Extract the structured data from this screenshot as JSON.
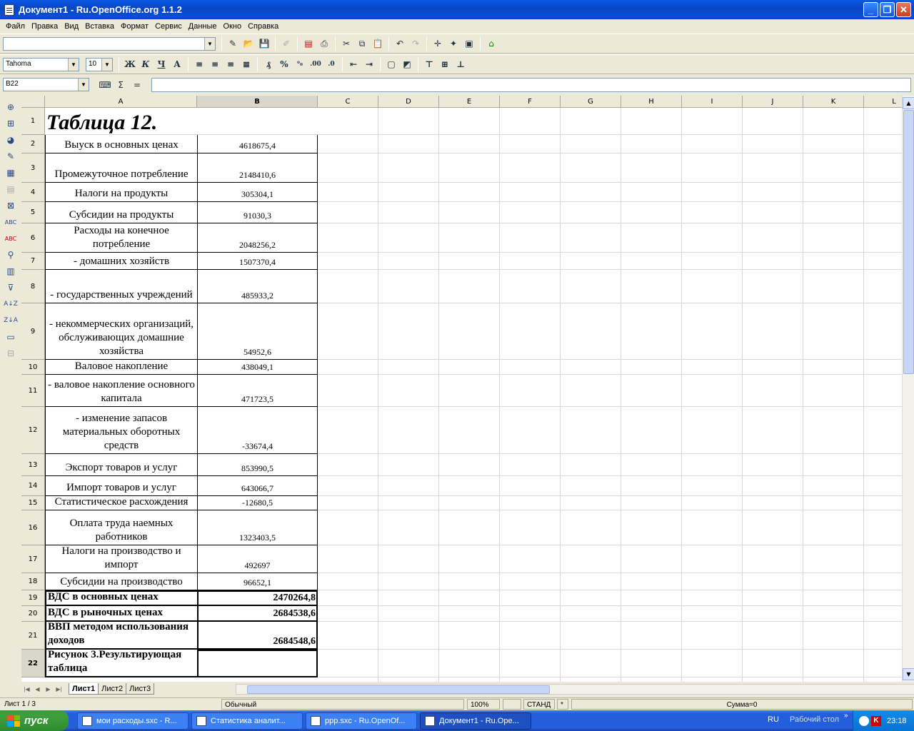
{
  "window": {
    "title": "Документ1 - Ru.OpenOffice.org 1.1.2",
    "minimize": "_",
    "maximize": "❐",
    "close": "✕"
  },
  "menu": [
    "Файл",
    "Правка",
    "Вид",
    "Вставка",
    "Формат",
    "Сервис",
    "Данные",
    "Окно",
    "Справка"
  ],
  "toolbar": {
    "font_name": "Tahoma",
    "font_size": "10",
    "bold": "Ж",
    "italic": "К",
    "underline": "Ч"
  },
  "formula_bar": {
    "cell_ref": "B22",
    "sum_symbol": "Σ",
    "equals": "=",
    "content": ""
  },
  "columns": [
    "A",
    "B",
    "C",
    "D",
    "E",
    "F",
    "G",
    "H",
    "I",
    "J",
    "K",
    "L"
  ],
  "selected_column": "B",
  "selected_row": "22",
  "title_cell": "Таблица 12.",
  "rows": [
    {
      "num": "1",
      "a": "",
      "b": ""
    },
    {
      "num": "2",
      "a": "Выуск в основных ценах",
      "b": "4618675,4"
    },
    {
      "num": "3",
      "a": "Промежуточное потребление",
      "b": "2148410,6"
    },
    {
      "num": "4",
      "a": "Налоги на продукты",
      "b": "305304,1"
    },
    {
      "num": "5",
      "a": "Субсидии на продукты",
      "b": "91030,3"
    },
    {
      "num": "6",
      "a": "Расходы на конечное потребление",
      "b": "2048256,2"
    },
    {
      "num": "7",
      "a": "- домашних хозяйств",
      "b": "1507370,4"
    },
    {
      "num": "8",
      "a": "- государственных учреждений",
      "b": "485933,2"
    },
    {
      "num": "9",
      "a": "- некоммерческих организаций, обслуживающих домашние хозяйства",
      "b": "54952,6"
    },
    {
      "num": "10",
      "a": "Валовое накопление",
      "b": "438049,1"
    },
    {
      "num": "11",
      "a": "- валовое накопление основного капитала",
      "b": "471723,5"
    },
    {
      "num": "12",
      "a": "- изменение запасов материальных оборотных средств",
      "b": "-33674,4"
    },
    {
      "num": "13",
      "a": "Экспорт товаров и услуг",
      "b": "853990,5"
    },
    {
      "num": "14",
      "a": "Импорт товаров и услуг",
      "b": "643066,7"
    },
    {
      "num": "15",
      "a": "Статистическое расхождения",
      "b": "-12680,5"
    },
    {
      "num": "16",
      "a": "Оплата труда наемных работников",
      "b": "1323403,5"
    },
    {
      "num": "17",
      "a": "Налоги на производство и импорт",
      "b": "492697"
    },
    {
      "num": "18",
      "a": "Субсидии на производство",
      "b": "96652,1"
    },
    {
      "num": "19",
      "a": "ВДС в основных ценах",
      "b": "2470264,8"
    },
    {
      "num": "20",
      "a": "ВДС в рыночных ценах",
      "b": "2684538,6"
    },
    {
      "num": "21",
      "a": "ВВП методом использования доходов",
      "b": "2684548,6"
    },
    {
      "num": "22",
      "a": "Рисунок 3.Результирующая таблица",
      "b": ""
    }
  ],
  "sheets": [
    "Лист1",
    "Лист2",
    "Лист3"
  ],
  "active_sheet": "Лист1",
  "status": {
    "sheet": "Лист 1 / 3",
    "style": "Обычный",
    "zoom": "100%",
    "mode": "СТАНД",
    "modified": "*",
    "sum": "Сумма=0"
  },
  "taskbar": {
    "start": "пуск",
    "tasks": [
      {
        "label": "мои расходы.sxc - R...",
        "active": false
      },
      {
        "label": "Статистика аналит...",
        "active": false
      },
      {
        "label": "ppp.sxc - Ru.OpenOf...",
        "active": false
      },
      {
        "label": "Документ1 - Ru.Ope...",
        "active": true
      }
    ],
    "lang": "RU",
    "desktop": "Рабочий стол",
    "time": "23:18"
  }
}
